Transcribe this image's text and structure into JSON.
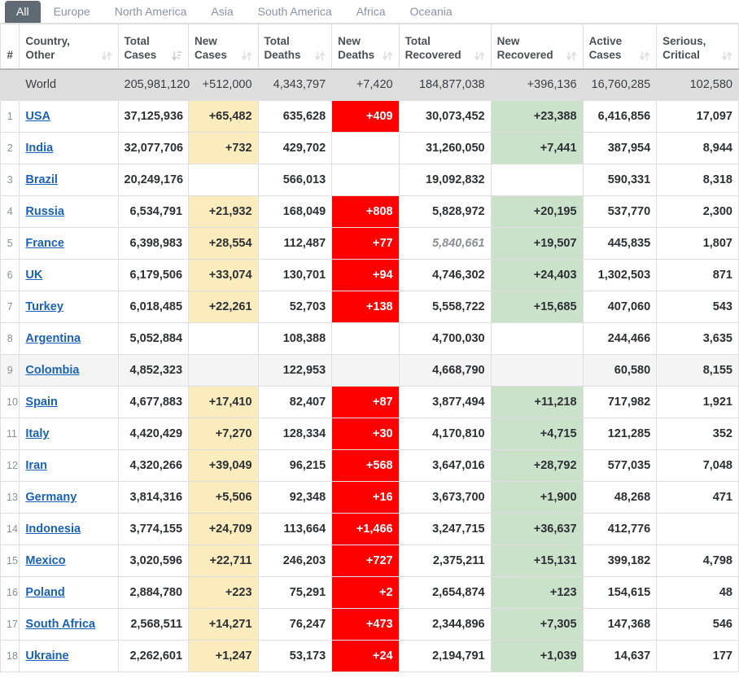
{
  "tabs": [
    {
      "label": "All",
      "active": true
    },
    {
      "label": "Europe",
      "active": false
    },
    {
      "label": "North America",
      "active": false
    },
    {
      "label": "Asia",
      "active": false
    },
    {
      "label": "South America",
      "active": false
    },
    {
      "label": "Africa",
      "active": false
    },
    {
      "label": "Oceania",
      "active": false
    }
  ],
  "colors": {
    "tab_active_bg": "#5f6a73",
    "tab_inactive_text": "#8a92a5",
    "new_cases_bg": "#fbecbe",
    "new_deaths_bg": "#ff0000",
    "new_recovered_bg": "#c9e2c9",
    "world_row_bg": "#dedede",
    "link": "#1a62b5"
  },
  "table": {
    "columns": [
      {
        "key": "rank",
        "line1": "",
        "line2": "#",
        "sort": "none"
      },
      {
        "key": "country",
        "line1": "Country,",
        "line2": "Other",
        "sort": "neutral"
      },
      {
        "key": "total_cases",
        "line1": "Total",
        "line2": "Cases",
        "sort": "desc"
      },
      {
        "key": "new_cases",
        "line1": "New",
        "line2": "Cases",
        "sort": "neutral"
      },
      {
        "key": "total_deaths",
        "line1": "Total",
        "line2": "Deaths",
        "sort": "neutral"
      },
      {
        "key": "new_deaths",
        "line1": "New",
        "line2": "Deaths",
        "sort": "neutral"
      },
      {
        "key": "total_recovered",
        "line1": "Total",
        "line2": "Recovered",
        "sort": "neutral"
      },
      {
        "key": "new_recovered",
        "line1": "New",
        "line2": "Recovered",
        "sort": "neutral"
      },
      {
        "key": "active_cases",
        "line1": "Active",
        "line2": "Cases",
        "sort": "neutral"
      },
      {
        "key": "serious_critical",
        "line1": "Serious,",
        "line2": "Critical",
        "sort": "neutral"
      }
    ],
    "world": {
      "rank": "",
      "country": "World",
      "total_cases": "205,981,120",
      "new_cases": "+512,000",
      "total_deaths": "4,343,797",
      "new_deaths": "+7,420",
      "total_recovered": "184,877,038",
      "new_recovered": "+396,136",
      "active_cases": "16,760,285",
      "serious_critical": "102,580"
    },
    "rows": [
      {
        "rank": "1",
        "country": "USA",
        "total_cases": "37,125,936",
        "new_cases": "+65,482",
        "total_deaths": "635,628",
        "new_deaths": "+409",
        "total_recovered": "30,073,452",
        "new_recovered": "+23,388",
        "active_cases": "6,416,856",
        "serious_critical": "17,097",
        "highlight": false,
        "recovered_muted": false
      },
      {
        "rank": "2",
        "country": "India",
        "total_cases": "32,077,706",
        "new_cases": "+732",
        "total_deaths": "429,702",
        "new_deaths": "",
        "total_recovered": "31,260,050",
        "new_recovered": "+7,441",
        "active_cases": "387,954",
        "serious_critical": "8,944",
        "highlight": false,
        "recovered_muted": false
      },
      {
        "rank": "3",
        "country": "Brazil",
        "total_cases": "20,249,176",
        "new_cases": "",
        "total_deaths": "566,013",
        "new_deaths": "",
        "total_recovered": "19,092,832",
        "new_recovered": "",
        "active_cases": "590,331",
        "serious_critical": "8,318",
        "highlight": false,
        "recovered_muted": false
      },
      {
        "rank": "4",
        "country": "Russia",
        "total_cases": "6,534,791",
        "new_cases": "+21,932",
        "total_deaths": "168,049",
        "new_deaths": "+808",
        "total_recovered": "5,828,972",
        "new_recovered": "+20,195",
        "active_cases": "537,770",
        "serious_critical": "2,300",
        "highlight": false,
        "recovered_muted": false
      },
      {
        "rank": "5",
        "country": "France",
        "total_cases": "6,398,983",
        "new_cases": "+28,554",
        "total_deaths": "112,487",
        "new_deaths": "+77",
        "total_recovered": "5,840,661",
        "new_recovered": "+19,507",
        "active_cases": "445,835",
        "serious_critical": "1,807",
        "highlight": false,
        "recovered_muted": true
      },
      {
        "rank": "6",
        "country": "UK",
        "total_cases": "6,179,506",
        "new_cases": "+33,074",
        "total_deaths": "130,701",
        "new_deaths": "+94",
        "total_recovered": "4,746,302",
        "new_recovered": "+24,403",
        "active_cases": "1,302,503",
        "serious_critical": "871",
        "highlight": false,
        "recovered_muted": false
      },
      {
        "rank": "7",
        "country": "Turkey",
        "total_cases": "6,018,485",
        "new_cases": "+22,261",
        "total_deaths": "52,703",
        "new_deaths": "+138",
        "total_recovered": "5,558,722",
        "new_recovered": "+15,685",
        "active_cases": "407,060",
        "serious_critical": "543",
        "highlight": false,
        "recovered_muted": false
      },
      {
        "rank": "8",
        "country": "Argentina",
        "total_cases": "5,052,884",
        "new_cases": "",
        "total_deaths": "108,388",
        "new_deaths": "",
        "total_recovered": "4,700,030",
        "new_recovered": "",
        "active_cases": "244,466",
        "serious_critical": "3,635",
        "highlight": false,
        "recovered_muted": false
      },
      {
        "rank": "9",
        "country": "Colombia",
        "total_cases": "4,852,323",
        "new_cases": "",
        "total_deaths": "122,953",
        "new_deaths": "",
        "total_recovered": "4,668,790",
        "new_recovered": "",
        "active_cases": "60,580",
        "serious_critical": "8,155",
        "highlight": true,
        "recovered_muted": false
      },
      {
        "rank": "10",
        "country": "Spain",
        "total_cases": "4,677,883",
        "new_cases": "+17,410",
        "total_deaths": "82,407",
        "new_deaths": "+87",
        "total_recovered": "3,877,494",
        "new_recovered": "+11,218",
        "active_cases": "717,982",
        "serious_critical": "1,921",
        "highlight": false,
        "recovered_muted": false
      },
      {
        "rank": "11",
        "country": "Italy",
        "total_cases": "4,420,429",
        "new_cases": "+7,270",
        "total_deaths": "128,334",
        "new_deaths": "+30",
        "total_recovered": "4,170,810",
        "new_recovered": "+4,715",
        "active_cases": "121,285",
        "serious_critical": "352",
        "highlight": false,
        "recovered_muted": false
      },
      {
        "rank": "12",
        "country": "Iran",
        "total_cases": "4,320,266",
        "new_cases": "+39,049",
        "total_deaths": "96,215",
        "new_deaths": "+568",
        "total_recovered": "3,647,016",
        "new_recovered": "+28,792",
        "active_cases": "577,035",
        "serious_critical": "7,048",
        "highlight": false,
        "recovered_muted": false
      },
      {
        "rank": "13",
        "country": "Germany",
        "total_cases": "3,814,316",
        "new_cases": "+5,506",
        "total_deaths": "92,348",
        "new_deaths": "+16",
        "total_recovered": "3,673,700",
        "new_recovered": "+1,900",
        "active_cases": "48,268",
        "serious_critical": "471",
        "highlight": false,
        "recovered_muted": false
      },
      {
        "rank": "14",
        "country": "Indonesia",
        "total_cases": "3,774,155",
        "new_cases": "+24,709",
        "total_deaths": "113,664",
        "new_deaths": "+1,466",
        "total_recovered": "3,247,715",
        "new_recovered": "+36,637",
        "active_cases": "412,776",
        "serious_critical": "",
        "highlight": false,
        "recovered_muted": false
      },
      {
        "rank": "15",
        "country": "Mexico",
        "total_cases": "3,020,596",
        "new_cases": "+22,711",
        "total_deaths": "246,203",
        "new_deaths": "+727",
        "total_recovered": "2,375,211",
        "new_recovered": "+15,131",
        "active_cases": "399,182",
        "serious_critical": "4,798",
        "highlight": false,
        "recovered_muted": false
      },
      {
        "rank": "16",
        "country": "Poland",
        "total_cases": "2,884,780",
        "new_cases": "+223",
        "total_deaths": "75,291",
        "new_deaths": "+2",
        "total_recovered": "2,654,874",
        "new_recovered": "+123",
        "active_cases": "154,615",
        "serious_critical": "48",
        "highlight": false,
        "recovered_muted": false
      },
      {
        "rank": "17",
        "country": "South Africa",
        "total_cases": "2,568,511",
        "new_cases": "+14,271",
        "total_deaths": "76,247",
        "new_deaths": "+473",
        "total_recovered": "2,344,896",
        "new_recovered": "+7,305",
        "active_cases": "147,368",
        "serious_critical": "546",
        "highlight": false,
        "recovered_muted": false
      },
      {
        "rank": "18",
        "country": "Ukraine",
        "total_cases": "2,262,601",
        "new_cases": "+1,247",
        "total_deaths": "53,173",
        "new_deaths": "+24",
        "total_recovered": "2,194,791",
        "new_recovered": "+1,039",
        "active_cases": "14,637",
        "serious_critical": "177",
        "highlight": false,
        "recovered_muted": false
      }
    ]
  }
}
